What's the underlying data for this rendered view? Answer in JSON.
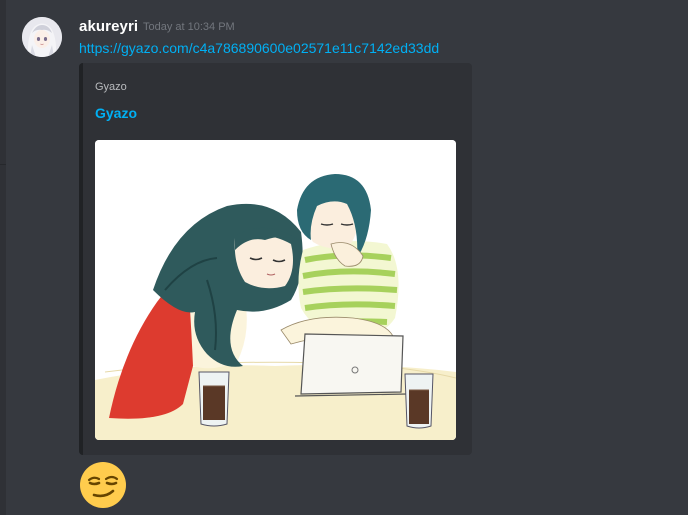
{
  "message": {
    "username": "akureyri",
    "timestamp": "Today at 10:34 PM",
    "link_text": "https://gyazo.com/c4a786890600e02571e11c7142ed33dd"
  },
  "embed": {
    "provider": "Gyazo",
    "title": "Gyazo",
    "image_icon": "illustration-two-girls-at-laptop"
  },
  "reaction": {
    "emoji_icon": "smirking-face-emoji"
  },
  "colors": {
    "background": "#36393f",
    "embed_background": "#2f3136",
    "link": "#00b0f4",
    "username": "#ffffff",
    "timestamp": "#72767d"
  }
}
